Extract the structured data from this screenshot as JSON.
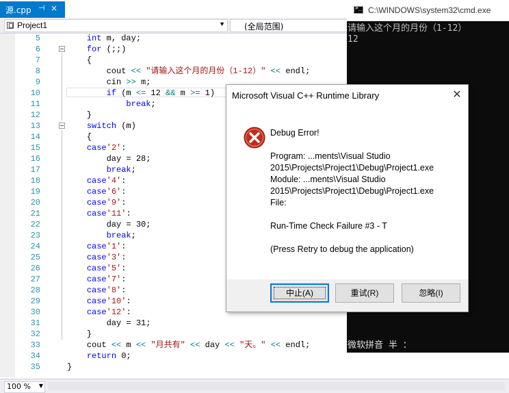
{
  "editor": {
    "tab": {
      "label": "源.cpp",
      "pin": "⊣",
      "close": "×"
    },
    "nav": {
      "project": "Project1",
      "scope": "(全局范围)"
    },
    "lines": [
      {
        "n": "5",
        "t": "    int m, day;"
      },
      {
        "n": "6",
        "t": "    for (;;)"
      },
      {
        "n": "7",
        "t": "    {"
      },
      {
        "n": "8",
        "t": "        cout << \"请输入这个月的月份（1-12）\" << endl;"
      },
      {
        "n": "9",
        "t": "        cin >> m;"
      },
      {
        "n": "10",
        "t": "        if (m <= 12 && m >= 1)"
      },
      {
        "n": "11",
        "t": "            break;"
      },
      {
        "n": "12",
        "t": "    }"
      },
      {
        "n": "13",
        "t": "    switch (m)"
      },
      {
        "n": "14",
        "t": "    {"
      },
      {
        "n": "15",
        "t": "    case'2':"
      },
      {
        "n": "16",
        "t": "        day = 28;"
      },
      {
        "n": "17",
        "t": "        break;"
      },
      {
        "n": "18",
        "t": "    case'4':"
      },
      {
        "n": "19",
        "t": "    case'6':"
      },
      {
        "n": "20",
        "t": "    case'9':"
      },
      {
        "n": "21",
        "t": "    case'11':"
      },
      {
        "n": "22",
        "t": "        day = 30;"
      },
      {
        "n": "23",
        "t": "        break;"
      },
      {
        "n": "24",
        "t": "    case'1':"
      },
      {
        "n": "25",
        "t": "    case'3':"
      },
      {
        "n": "26",
        "t": "    case'5':"
      },
      {
        "n": "27",
        "t": "    case'7':"
      },
      {
        "n": "28",
        "t": "    case'8':"
      },
      {
        "n": "29",
        "t": "    case'10':"
      },
      {
        "n": "30",
        "t": "    case'12':"
      },
      {
        "n": "31",
        "t": "        day = 31;"
      },
      {
        "n": "32",
        "t": "    }"
      },
      {
        "n": "33",
        "t": "    cout << m << \"月共有\" << day << \"天。\" << endl;"
      },
      {
        "n": "34",
        "t": "    return 0;"
      },
      {
        "n": "35",
        "t": "}"
      }
    ],
    "zoom": "100 %"
  },
  "console": {
    "title": "C:\\WINDOWS\\system32\\cmd.exe",
    "lines": [
      "请输入这个月的月份（1-12）",
      "12"
    ],
    "ime": "微软拼音 半 ："
  },
  "dialog": {
    "title": "Microsoft Visual C++ Runtime Library",
    "close": "✕",
    "heading": "Debug Error!",
    "program_line1": "Program: ...ments\\Visual Studio",
    "program_line2": "2015\\Projects\\Project1\\Debug\\Project1.exe",
    "module_line1": "Module: ...ments\\Visual Studio",
    "module_line2": "2015\\Projects\\Project1\\Debug\\Project1.exe",
    "file": "File:",
    "message": "Run-Time Check Failure #3 - T",
    "hint": "(Press Retry to debug the application)",
    "buttons": {
      "abort": "中止(A)",
      "retry": "重试(R)",
      "ignore": "忽略(I)"
    }
  }
}
